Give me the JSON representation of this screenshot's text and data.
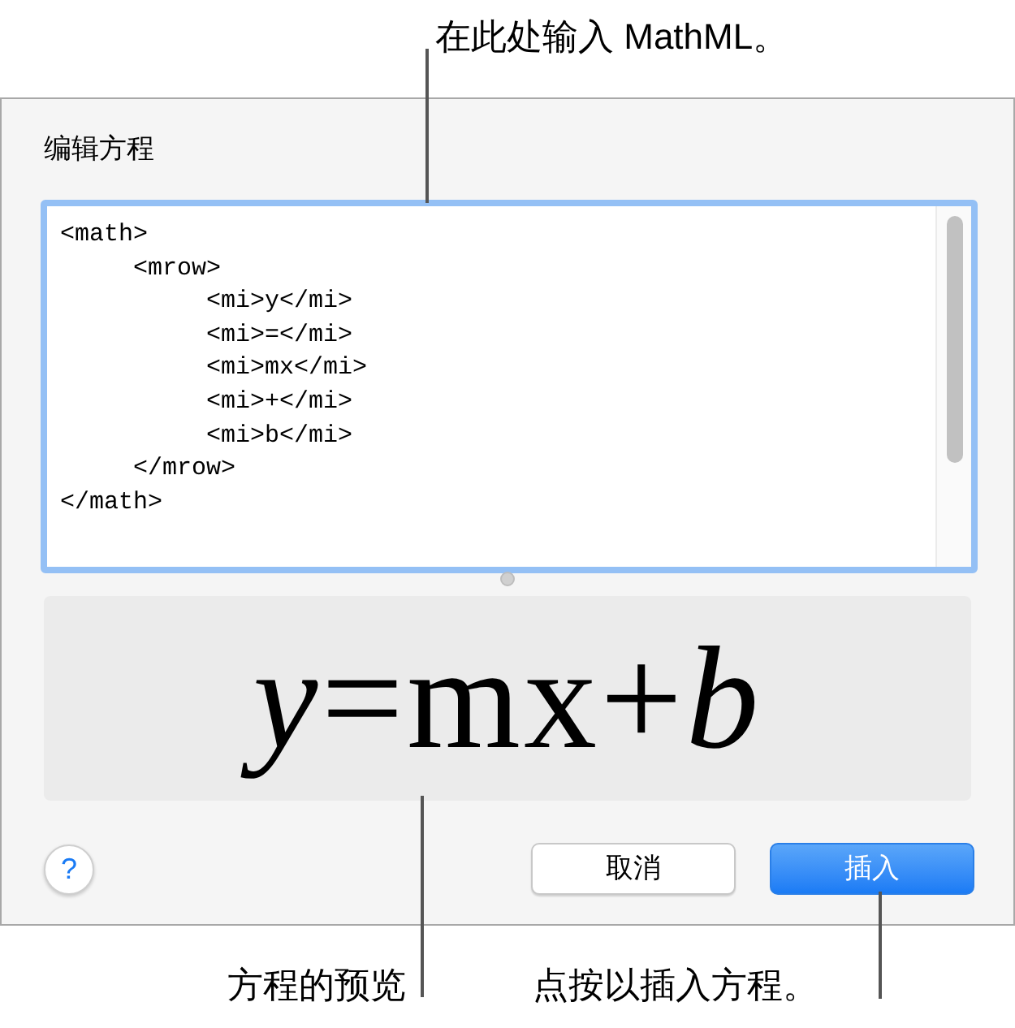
{
  "annotations": {
    "top": "在此处输入 MathML。"
  },
  "dialog": {
    "title": "编辑方程",
    "editor": {
      "focused": true,
      "lines": [
        "<math>",
        "     <mrow>",
        "          <mi>y</mi>",
        "          <mi>=</mi>",
        "          <mi>mx</mi>",
        "          <mi>+</mi>",
        "          <mi>b</mi>",
        "     </mrow>",
        "</math>"
      ]
    },
    "preview": "*y*=mx+*b*",
    "help": "?",
    "buttons": [
      {
        "label": "取消",
        "kind": "secondary"
      },
      {
        "label": "插入",
        "kind": "primary"
      }
    ]
  },
  "bottom_annotations": {
    "preview": "方程的预览",
    "insert": "点按以插入方程。"
  }
}
